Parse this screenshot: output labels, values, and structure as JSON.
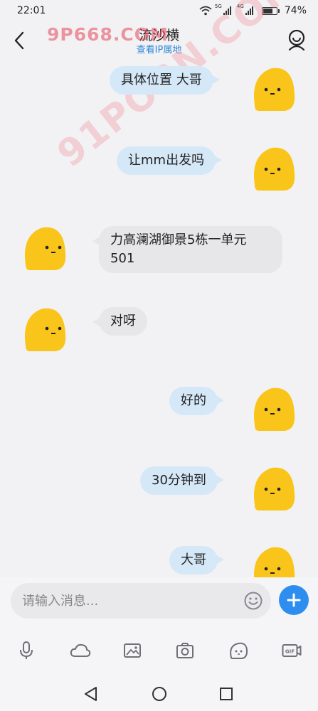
{
  "status_bar": {
    "time": "22:01",
    "signal1_label": "5G",
    "signal2_label": "4G",
    "battery_level": 0.74,
    "battery_text": "74%"
  },
  "header": {
    "contact_name": "流沙横",
    "ip_link": "查看IP属地"
  },
  "watermarks": {
    "top": "9P668.COM",
    "diagonal": "91PORN.COM"
  },
  "messages": [
    {
      "direction": "out",
      "text": "具体位置 大哥"
    },
    {
      "direction": "out",
      "text": "让mm出发吗"
    },
    {
      "direction": "in",
      "text_line1": "力高澜湖御景5栋一单元",
      "text_line2": "501"
    },
    {
      "direction": "in",
      "text": "对呀"
    },
    {
      "direction": "out",
      "text": "好的"
    },
    {
      "direction": "out",
      "text": "30分钟到"
    },
    {
      "direction": "out",
      "text": "大哥"
    }
  ],
  "input_bar": {
    "placeholder": "请输入消息...",
    "tools": [
      "microphone-icon",
      "cloud-icon",
      "image-icon",
      "camera-icon",
      "sticker-icon",
      "gif-icon"
    ],
    "tool_gif_label": "GIF"
  },
  "colors": {
    "accent": "#2d8ef0",
    "outgoing_bubble": "#d5e8f8",
    "incoming_bubble": "#e7e7ea",
    "avatar_yellow": "#f9c51a",
    "ip_link": "#2e87d8"
  }
}
